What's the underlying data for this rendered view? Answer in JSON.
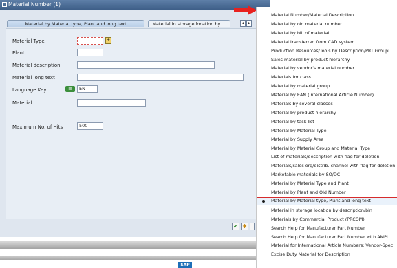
{
  "dialog": {
    "title": "Material Number (1)",
    "tabs": [
      {
        "label": "Material by Material type, Plant and long text",
        "active": true
      },
      {
        "label": "Material in storage location by ...",
        "active": false
      }
    ],
    "fields": {
      "material_type": {
        "label": "Material Type",
        "value": ""
      },
      "plant": {
        "label": "Plant",
        "value": ""
      },
      "material_description": {
        "label": "Material description",
        "value": ""
      },
      "material_long_text": {
        "label": "Material long text",
        "value": ""
      },
      "language_key": {
        "label": "Language Key",
        "value": "EN"
      },
      "material": {
        "label": "Material",
        "value": ""
      },
      "max_hits": {
        "label": "Maximum No. of Hits",
        "value": "500"
      }
    }
  },
  "footer": {
    "logo_text": "SAP"
  },
  "dropdown": {
    "items": [
      "Material Number/Material Description",
      "Material by old material number",
      "Material by bill of material",
      "Material transferred from CAD system",
      "Production Resources/Tools by Description/PRT Groupi",
      "Sales material by product hierarchy",
      "Material by vendor's material number",
      "Materials for class",
      "Material by material group",
      "Material by EAN (International Article Number)",
      "Materials by several classes",
      "Material by product hierarchy",
      "Material by task list",
      "Material by Material Type",
      "Material by Supply Area",
      "Material by Material Group and Material Type",
      "List of  materials/description with flag for deletion",
      "Materials/sales org/distrib. channel with flag for deletion",
      "Marketable materials by SO/DC",
      "Material by Material Type and Plant",
      "Material by Plant and Old Number",
      "Material by Material type, Plant and long text",
      "Material in storage location by description/bin",
      "Materials by Commercial Product (PRCOM)",
      "Search Help for Manufacturer Part Number",
      "Search Help for Manufacturer Part Number with AMPL",
      "Material for International Article Numbers: Vendor-Spec",
      "Excise Duty Material for Description"
    ],
    "selected_index": 21
  },
  "colors": {
    "accent_red": "#d62c2c",
    "title_bar": "#4a6d96",
    "panel": "#dfe6ef"
  }
}
